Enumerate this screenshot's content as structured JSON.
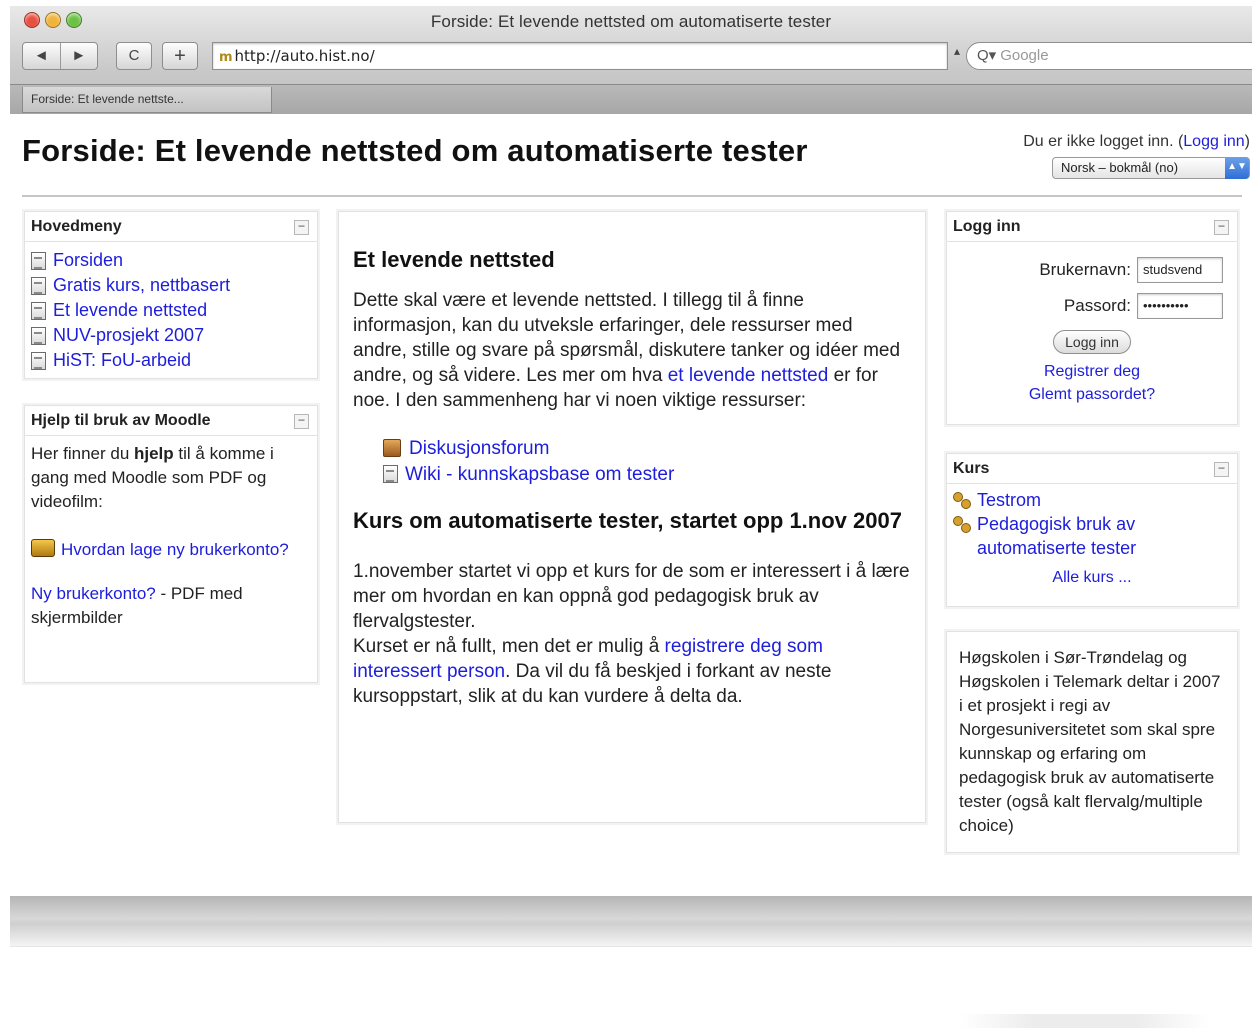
{
  "browser": {
    "window_title": "Forside: Et levende nettsted om automatiserte tester",
    "back_label": "◄",
    "forward_label": "►",
    "reload_label": "C",
    "add_bookmark_label": "+",
    "url": "http://auto.hist.no/",
    "search_placeholder": "Google",
    "tab_label": "Forside: Et levende nettste..."
  },
  "page": {
    "title": "Forside: Et levende nettsted om automatiserte tester",
    "login_status": "Du er ikke logget inn. (",
    "login_link": "Logg inn",
    "login_status_end": ")",
    "language": "Norsk – bokmål (no)"
  },
  "main_menu": {
    "title": "Hovedmeny",
    "items": [
      "Forsiden",
      "Gratis kurs, nettbasert",
      "Et levende nettsted",
      "NUV-prosjekt 2007",
      "HiST: FoU-arbeid"
    ]
  },
  "help": {
    "title": "Hjelp til bruk av Moodle",
    "intro_before": "Her finner du ",
    "intro_bold": "hjelp",
    "intro_after": " til å komme i gang med Moodle som PDF og videofilm:",
    "video_link": "Hvordan lage ny brukerkonto?",
    "pdf_link": "Ny brukerkonto?",
    "pdf_text": " - PDF med skjermbilder"
  },
  "main": {
    "heading1": "Et levende nettsted",
    "para1_before": "Dette skal være et levende nettsted. I tillegg til å finne informasjon, kan du utveksle erfaringer, dele ressurser med andre, stille og svare på spørsmål, diskutere tanker og idéer med andre, og så videre. Les mer om hva ",
    "para1_link": "et levende nettsted",
    "para1_after": " er for noe. I den sammenheng har vi noen viktige ressurser:",
    "resources": [
      "Diskusjonsforum",
      "Wiki - kunnskapsbase om tester"
    ],
    "heading2": "Kurs om automatiserte tester, startet opp 1.nov 2007",
    "para2": "1.november startet vi opp et kurs for de som er interessert i å lære mer om hvordan en kan oppnå god pedagogisk bruk av flervalgstester.",
    "para3_before": "Kurset er nå fullt, men det er mulig å ",
    "para3_link": "registrere deg som interessert person",
    "para3_after": ". Da vil du få beskjed i forkant av neste kursoppstart, slik at du kan vurdere å delta da."
  },
  "login": {
    "title": "Logg inn",
    "username_label": "Brukernavn:",
    "username_value": "studsvend",
    "password_label": "Passord:",
    "password_value": "••••••••••",
    "button": "Logg inn",
    "register_link": "Registrer deg",
    "forgot_link": "Glemt passordet?"
  },
  "courses": {
    "title": "Kurs",
    "items": [
      "Testrom",
      "Pedagogisk bruk av automatiserte tester"
    ],
    "all_link": "Alle kurs ..."
  },
  "info": {
    "text": "Høgskolen i Sør-Trøndelag og Høgskolen i Telemark deltar i 2007 i et prosjekt i regi av Norgesuniversitetet som skal spre kunnskap og erfaring om pedagogisk bruk av automatiserte tester (også kalt flervalg/multiple choice)"
  }
}
